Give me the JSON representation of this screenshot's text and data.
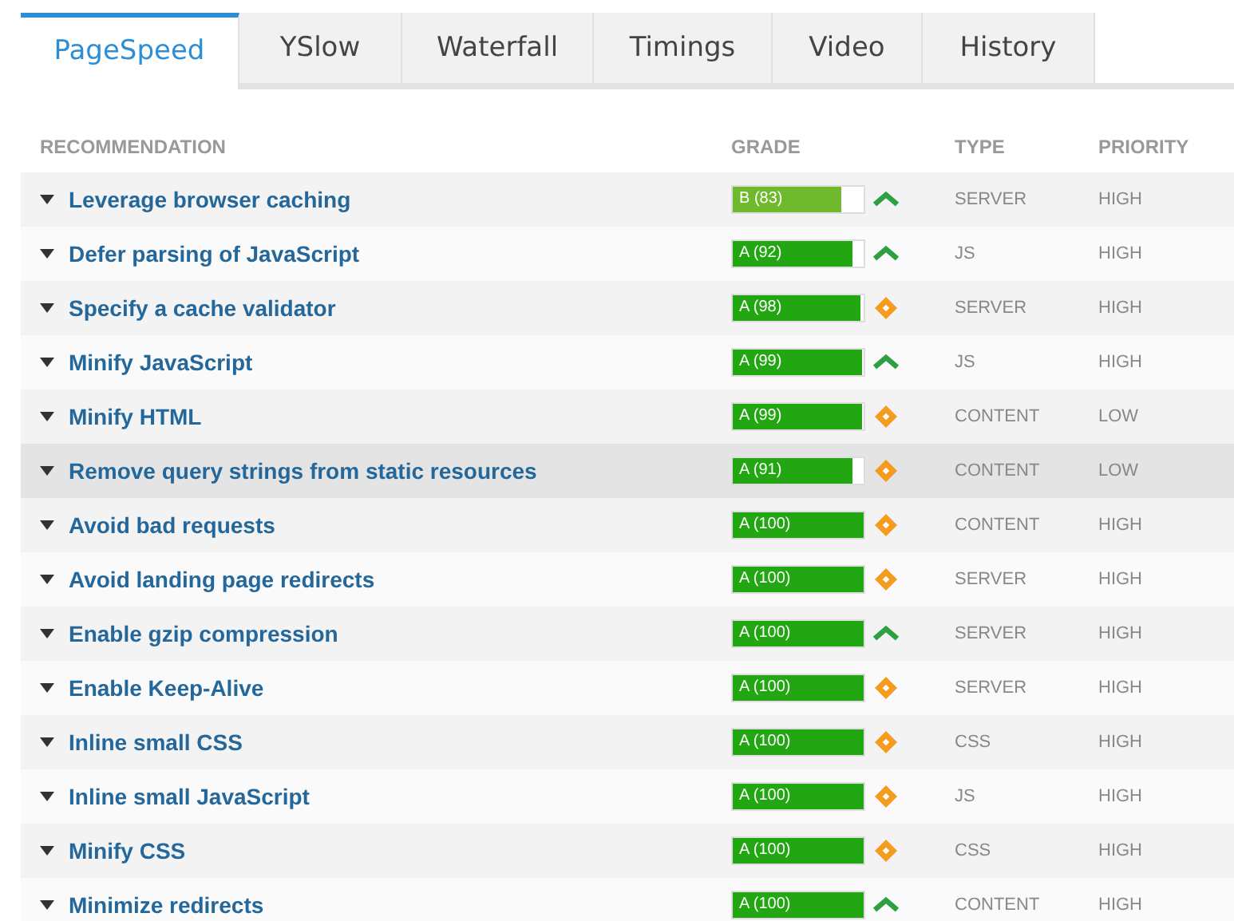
{
  "tabs": [
    {
      "label": "PageSpeed",
      "selected": true
    },
    {
      "label": "YSlow",
      "selected": false
    },
    {
      "label": "Waterfall",
      "selected": false
    },
    {
      "label": "Timings",
      "selected": false
    },
    {
      "label": "Video",
      "selected": false
    },
    {
      "label": "History",
      "selected": false
    }
  ],
  "table": {
    "columns": [
      "RECOMMENDATION",
      "GRADE",
      "TYPE",
      "PRIORITY"
    ],
    "rows": [
      {
        "recommendation": "Leverage browser caching",
        "grade": "B (83)",
        "level": 0.83,
        "color": "#6fba2c",
        "kind": "up",
        "type": "SERVER",
        "priority": "HIGH",
        "selected": false
      },
      {
        "recommendation": "Defer parsing of JavaScript",
        "grade": "A (92)",
        "level": 0.92,
        "color": "#22a612",
        "kind": "up",
        "type": "JS",
        "priority": "HIGH",
        "selected": false
      },
      {
        "recommendation": "Specify a cache validator",
        "grade": "A (98)",
        "level": 0.98,
        "color": "#22a612",
        "kind": "diamond",
        "type": "SERVER",
        "priority": "HIGH",
        "selected": false
      },
      {
        "recommendation": "Minify JavaScript",
        "grade": "A (99)",
        "level": 0.99,
        "color": "#22a612",
        "kind": "up",
        "type": "JS",
        "priority": "HIGH",
        "selected": false
      },
      {
        "recommendation": "Minify HTML",
        "grade": "A (99)",
        "level": 0.99,
        "color": "#22a612",
        "kind": "diamond",
        "type": "CONTENT",
        "priority": "LOW",
        "selected": false
      },
      {
        "recommendation": "Remove query strings from static resources",
        "grade": "A (91)",
        "level": 0.91,
        "color": "#22a612",
        "kind": "diamond",
        "type": "CONTENT",
        "priority": "LOW",
        "selected": true
      },
      {
        "recommendation": "Avoid bad requests",
        "grade": "A (100)",
        "level": 1,
        "color": "#22a612",
        "kind": "diamond",
        "type": "CONTENT",
        "priority": "HIGH",
        "selected": false
      },
      {
        "recommendation": "Avoid landing page redirects",
        "grade": "A (100)",
        "level": 1,
        "color": "#22a612",
        "kind": "diamond",
        "type": "SERVER",
        "priority": "HIGH",
        "selected": false
      },
      {
        "recommendation": "Enable gzip compression",
        "grade": "A (100)",
        "level": 1,
        "color": "#22a612",
        "kind": "up",
        "type": "SERVER",
        "priority": "HIGH",
        "selected": false
      },
      {
        "recommendation": "Enable Keep-Alive",
        "grade": "A (100)",
        "level": 1,
        "color": "#22a612",
        "kind": "diamond",
        "type": "SERVER",
        "priority": "HIGH",
        "selected": false
      },
      {
        "recommendation": "Inline small CSS",
        "grade": "A (100)",
        "level": 1,
        "color": "#22a612",
        "kind": "diamond",
        "type": "CSS",
        "priority": "HIGH",
        "selected": false
      },
      {
        "recommendation": "Inline small JavaScript",
        "grade": "A (100)",
        "level": 1,
        "color": "#22a612",
        "kind": "diamond",
        "type": "JS",
        "priority": "HIGH",
        "selected": false
      },
      {
        "recommendation": "Minify CSS",
        "grade": "A (100)",
        "level": 1,
        "color": "#22a612",
        "kind": "diamond",
        "type": "CSS",
        "priority": "HIGH",
        "selected": false
      },
      {
        "recommendation": "Minimize redirects",
        "grade": "A (100)",
        "level": 1,
        "color": "#22a612",
        "kind": "up",
        "type": "CONTENT",
        "priority": "HIGH",
        "selected": false
      }
    ]
  }
}
